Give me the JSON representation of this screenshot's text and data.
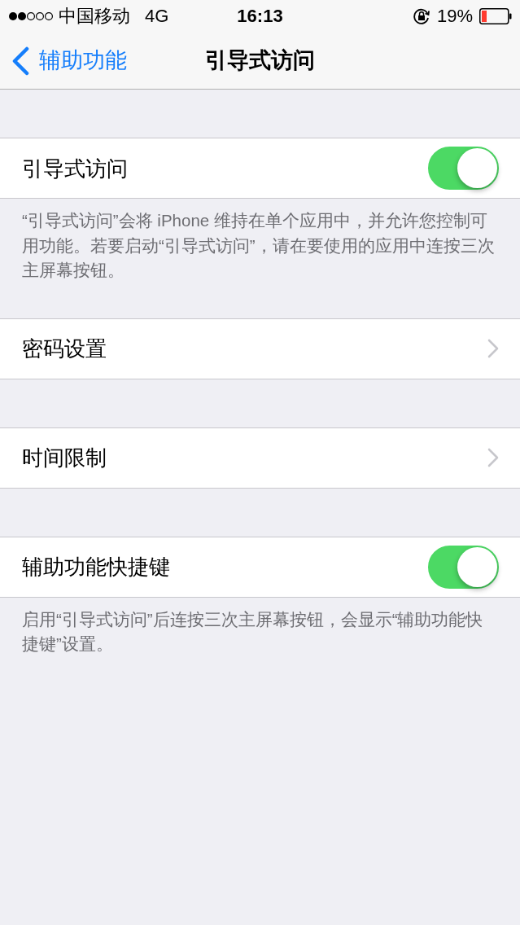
{
  "status_bar": {
    "carrier": "中国移动",
    "network": "4G",
    "time": "16:13",
    "battery_percent": "19%"
  },
  "nav_bar": {
    "back_label": "辅助功能",
    "title": "引导式访问"
  },
  "sections": [
    {
      "rows": [
        {
          "kind": "toggle",
          "label": "引导式访问",
          "on": true
        }
      ],
      "footer": "“引导式访问”会将 iPhone 维持在单个应用中，并允许您控制可用功能。若要启动“引导式访问”，请在要使用的应用中连按三次主屏幕按钮。"
    },
    {
      "rows": [
        {
          "kind": "link",
          "label": "密码设置"
        }
      ]
    },
    {
      "rows": [
        {
          "kind": "link",
          "label": "时间限制"
        }
      ]
    },
    {
      "rows": [
        {
          "kind": "toggle",
          "label": "辅助功能快捷键",
          "on": true
        }
      ],
      "footer": "启用“引导式访问”后连按三次主屏幕按钮，会显示“辅助功能快捷键”设置。"
    }
  ]
}
